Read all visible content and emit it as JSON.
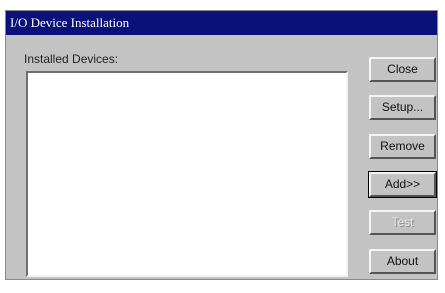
{
  "window": {
    "title": "I/O Device Installation"
  },
  "list": {
    "label": "Installed Devices:",
    "items": []
  },
  "buttons": {
    "close": "Close",
    "setup": "Setup...",
    "remove": "Remove",
    "add": "Add>>",
    "test": "Test",
    "about": "About"
  },
  "colors": {
    "titlebar": "#0a127a",
    "dialog_bg": "#c3c3c3",
    "list_bg": "#ffffff"
  }
}
